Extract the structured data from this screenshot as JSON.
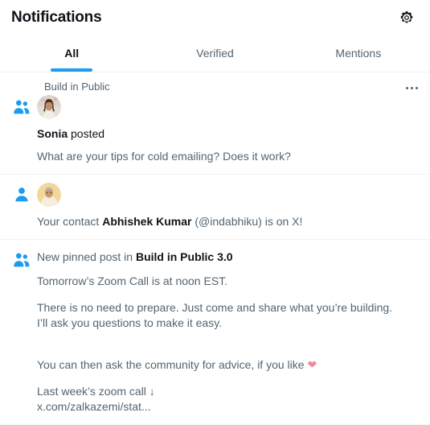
{
  "header": {
    "title": "Notifications",
    "settings_icon": "gear-icon"
  },
  "tabs": [
    {
      "label": "All",
      "active": true
    },
    {
      "label": "Verified",
      "active": false
    },
    {
      "label": "Mentions",
      "active": false
    }
  ],
  "accent_color": "#1d9bf0",
  "notifications": [
    {
      "type_icon": "people-group-icon",
      "community": "Build in Public",
      "more_icon": "more-horizontal-icon",
      "avatar": "avatar-sonia",
      "actor": "Sonia",
      "action": " posted",
      "preview": "What are your tips for cold emailing? Does it work?"
    },
    {
      "type_icon": "person-icon",
      "avatar": "avatar-abhishek",
      "text_before": "Your contact ",
      "actor": "Abhishek Kumar",
      "text_after": " (@indabhiku) is on X!"
    },
    {
      "type_icon": "people-group-icon",
      "headline_before": "New pinned post in ",
      "headline_bold": "Build in Public",
      "headline_after": " 3.0",
      "paragraphs": [
        "Tomorrow’s Zoom Call is at noon EST.",
        "There is no need to prepare. Just come and share what you’re building.\nI’ll ask you questions to make it easy."
      ],
      "like_line": "You can then ask the community for advice, if you like ",
      "heart": "❤",
      "heart_color": "#f0879c",
      "link_line": "Last week’s zoom call ↓\nx.com/zalkazemi/stat..."
    }
  ]
}
